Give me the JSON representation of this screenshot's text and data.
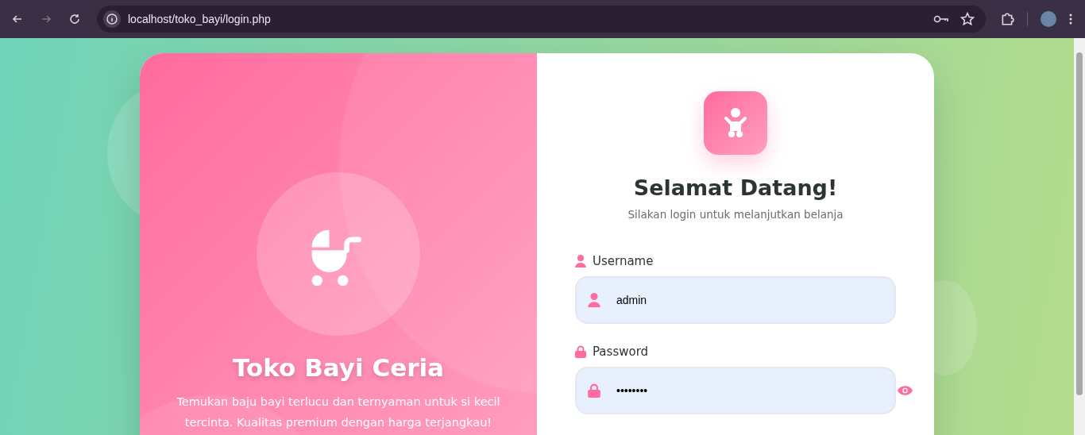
{
  "browser": {
    "url": "localhost/toko_bayi/login.php"
  },
  "hero": {
    "title": "Toko Bayi Ceria",
    "description": "Temukan baju bayi terlucu dan ternyaman untuk si kecil tercinta. Kualitas premium dengan harga terjangkau!"
  },
  "login": {
    "title": "Selamat Datang!",
    "subtitle": "Silakan login untuk melanjutkan belanja",
    "fields": [
      {
        "kind": "user",
        "label": "Username",
        "value": "admin"
      },
      {
        "kind": "password",
        "label": "Password",
        "value": "••••••••"
      }
    ]
  }
}
